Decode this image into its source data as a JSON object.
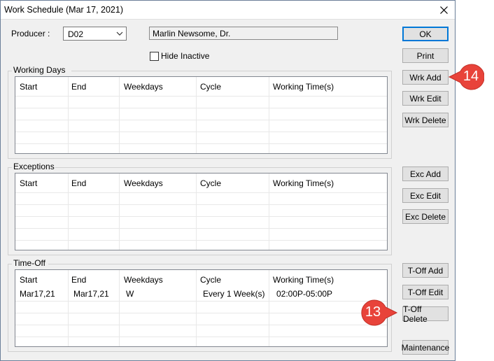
{
  "window": {
    "title": "Work Schedule (Mar 17, 2021)"
  },
  "producer": {
    "label": "Producer :",
    "selected": "D02",
    "name": "Marlin Newsome, Dr."
  },
  "hide_inactive": {
    "label": "Hide Inactive",
    "checked": false
  },
  "columns": [
    "Start",
    "End",
    "Weekdays",
    "Cycle",
    "Working Time(s)"
  ],
  "working_days": {
    "title": "Working Days",
    "rows": []
  },
  "exceptions": {
    "title": "Exceptions",
    "rows": []
  },
  "time_off": {
    "title": "Time-Off",
    "rows": [
      {
        "start": "Mar17,21",
        "end": "Mar17,21",
        "weekdays": "W",
        "cycle": "Every 1 Week(s)",
        "working_times": "02:00P-05:00P"
      }
    ]
  },
  "buttons": {
    "ok": "OK",
    "print": "Print",
    "wrk_add": "Wrk Add",
    "wrk_edit": "Wrk Edit",
    "wrk_delete": "Wrk Delete",
    "exc_add": "Exc Add",
    "exc_edit": "Exc Edit",
    "exc_delete": "Exc Delete",
    "toff_add": "T-Off Add",
    "toff_edit": "T-Off Edit",
    "toff_delete": "T-Off Delete",
    "maintenance": "Maintenance"
  },
  "callouts": {
    "c14": "14",
    "c13": "13",
    "color": "#e8433a"
  },
  "icons": {
    "close": "close-icon",
    "dropdown": "chevron-down-icon"
  }
}
